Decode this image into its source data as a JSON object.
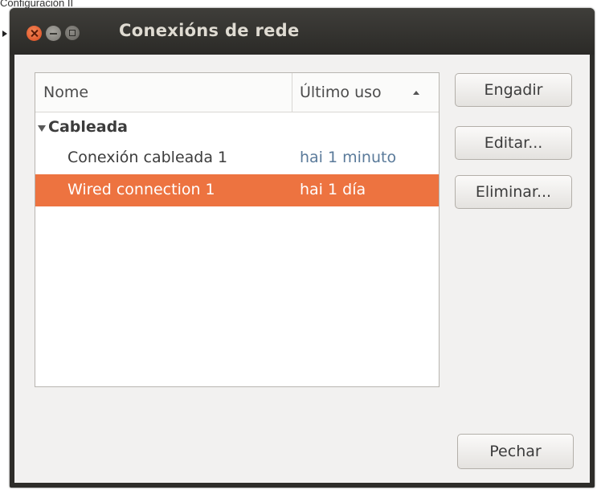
{
  "caption": "Configuración II",
  "window": {
    "title": "Conexións de rede"
  },
  "list": {
    "columns": [
      "Nome",
      "Último uso"
    ],
    "group": "Cableada",
    "rows": [
      {
        "name": "Conexión cableada 1",
        "last_used": "hai 1 minuto",
        "selected": false
      },
      {
        "name": "Wired connection 1",
        "last_used": "hai 1 día",
        "selected": true
      }
    ]
  },
  "buttons": {
    "add": "Engadir",
    "edit": "Editar...",
    "delete": "Eliminar...",
    "close": "Pechar"
  },
  "colors": {
    "selection": "#ed7340",
    "close_button": "#e05a27",
    "titlebar": "#3a3935"
  }
}
